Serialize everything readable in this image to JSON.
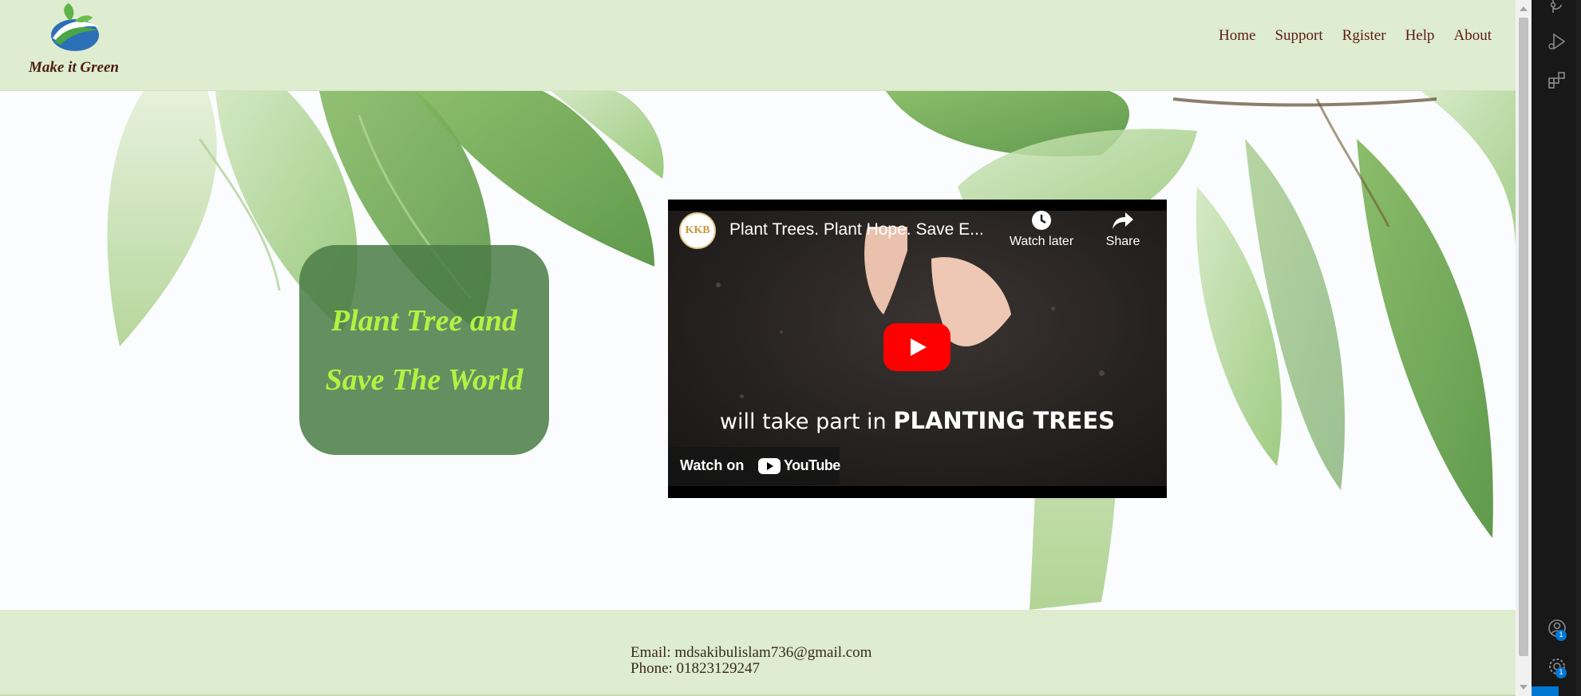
{
  "brand": {
    "name": "Make it Green",
    "logo_icon": "leaf-logo-icon"
  },
  "nav": {
    "items": [
      {
        "label": "Home"
      },
      {
        "label": "Support"
      },
      {
        "label": "Rgister"
      },
      {
        "label": "Help"
      },
      {
        "label": "About"
      }
    ]
  },
  "hero": {
    "tagline_line1": "Plant Tree and",
    "tagline_line2": "Save The World"
  },
  "video": {
    "channel_initials": "KKB",
    "title": "Plant Trees. Plant Hope. Save E...",
    "watch_later_label": "Watch later",
    "share_label": "Share",
    "caption_prefix": "will take part in ",
    "caption_emphasis": "PLANTING TREES",
    "watch_on_label": "Watch on",
    "youtube_label": "YouTube"
  },
  "footer": {
    "email_line": "Email: mdsakibulislam736@gmail.com",
    "phone_line": "Phone: 01823129247"
  },
  "activity_bar": {
    "accounts_badge": "1",
    "settings_badge": "1"
  },
  "colors": {
    "nav_bg": "#deecd0",
    "nav_link": "#5e1d12",
    "tagline_box": "#4a7d46",
    "tagline_text": "#b2f243",
    "youtube_red": "#ff0000"
  }
}
